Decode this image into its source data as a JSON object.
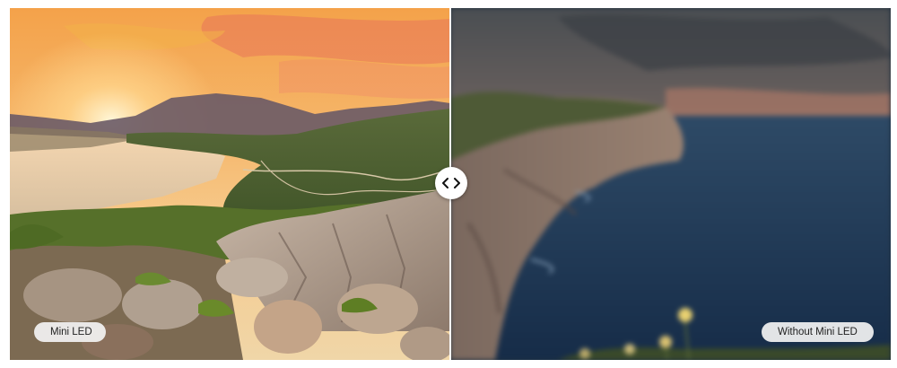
{
  "comparison": {
    "left_label": "Mini LED",
    "right_label": "Without Mini LED",
    "handle_icon": "chevron-left-right-icon",
    "split_fraction": 0.5
  }
}
